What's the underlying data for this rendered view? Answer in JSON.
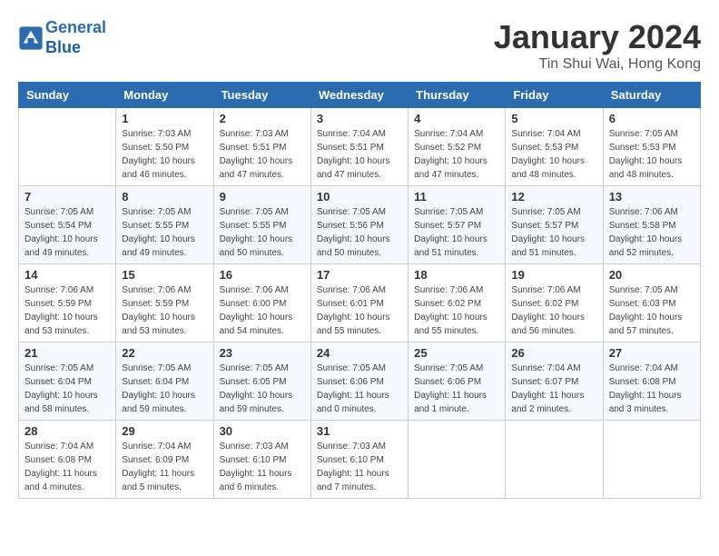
{
  "header": {
    "logo_line1": "General",
    "logo_line2": "Blue",
    "month_title": "January 2024",
    "location": "Tin Shui Wai, Hong Kong"
  },
  "weekdays": [
    "Sunday",
    "Monday",
    "Tuesday",
    "Wednesday",
    "Thursday",
    "Friday",
    "Saturday"
  ],
  "weeks": [
    [
      {
        "day": "",
        "sunrise": "",
        "sunset": "",
        "daylight": ""
      },
      {
        "day": "1",
        "sunrise": "Sunrise: 7:03 AM",
        "sunset": "Sunset: 5:50 PM",
        "daylight": "Daylight: 10 hours and 46 minutes."
      },
      {
        "day": "2",
        "sunrise": "Sunrise: 7:03 AM",
        "sunset": "Sunset: 5:51 PM",
        "daylight": "Daylight: 10 hours and 47 minutes."
      },
      {
        "day": "3",
        "sunrise": "Sunrise: 7:04 AM",
        "sunset": "Sunset: 5:51 PM",
        "daylight": "Daylight: 10 hours and 47 minutes."
      },
      {
        "day": "4",
        "sunrise": "Sunrise: 7:04 AM",
        "sunset": "Sunset: 5:52 PM",
        "daylight": "Daylight: 10 hours and 47 minutes."
      },
      {
        "day": "5",
        "sunrise": "Sunrise: 7:04 AM",
        "sunset": "Sunset: 5:53 PM",
        "daylight": "Daylight: 10 hours and 48 minutes."
      },
      {
        "day": "6",
        "sunrise": "Sunrise: 7:05 AM",
        "sunset": "Sunset: 5:53 PM",
        "daylight": "Daylight: 10 hours and 48 minutes."
      }
    ],
    [
      {
        "day": "7",
        "sunrise": "Sunrise: 7:05 AM",
        "sunset": "Sunset: 5:54 PM",
        "daylight": "Daylight: 10 hours and 49 minutes."
      },
      {
        "day": "8",
        "sunrise": "Sunrise: 7:05 AM",
        "sunset": "Sunset: 5:55 PM",
        "daylight": "Daylight: 10 hours and 49 minutes."
      },
      {
        "day": "9",
        "sunrise": "Sunrise: 7:05 AM",
        "sunset": "Sunset: 5:55 PM",
        "daylight": "Daylight: 10 hours and 50 minutes."
      },
      {
        "day": "10",
        "sunrise": "Sunrise: 7:05 AM",
        "sunset": "Sunset: 5:56 PM",
        "daylight": "Daylight: 10 hours and 50 minutes."
      },
      {
        "day": "11",
        "sunrise": "Sunrise: 7:05 AM",
        "sunset": "Sunset: 5:57 PM",
        "daylight": "Daylight: 10 hours and 51 minutes."
      },
      {
        "day": "12",
        "sunrise": "Sunrise: 7:05 AM",
        "sunset": "Sunset: 5:57 PM",
        "daylight": "Daylight: 10 hours and 51 minutes."
      },
      {
        "day": "13",
        "sunrise": "Sunrise: 7:06 AM",
        "sunset": "Sunset: 5:58 PM",
        "daylight": "Daylight: 10 hours and 52 minutes."
      }
    ],
    [
      {
        "day": "14",
        "sunrise": "Sunrise: 7:06 AM",
        "sunset": "Sunset: 5:59 PM",
        "daylight": "Daylight: 10 hours and 53 minutes."
      },
      {
        "day": "15",
        "sunrise": "Sunrise: 7:06 AM",
        "sunset": "Sunset: 5:59 PM",
        "daylight": "Daylight: 10 hours and 53 minutes."
      },
      {
        "day": "16",
        "sunrise": "Sunrise: 7:06 AM",
        "sunset": "Sunset: 6:00 PM",
        "daylight": "Daylight: 10 hours and 54 minutes."
      },
      {
        "day": "17",
        "sunrise": "Sunrise: 7:06 AM",
        "sunset": "Sunset: 6:01 PM",
        "daylight": "Daylight: 10 hours and 55 minutes."
      },
      {
        "day": "18",
        "sunrise": "Sunrise: 7:06 AM",
        "sunset": "Sunset: 6:02 PM",
        "daylight": "Daylight: 10 hours and 55 minutes."
      },
      {
        "day": "19",
        "sunrise": "Sunrise: 7:06 AM",
        "sunset": "Sunset: 6:02 PM",
        "daylight": "Daylight: 10 hours and 56 minutes."
      },
      {
        "day": "20",
        "sunrise": "Sunrise: 7:05 AM",
        "sunset": "Sunset: 6:03 PM",
        "daylight": "Daylight: 10 hours and 57 minutes."
      }
    ],
    [
      {
        "day": "21",
        "sunrise": "Sunrise: 7:05 AM",
        "sunset": "Sunset: 6:04 PM",
        "daylight": "Daylight: 10 hours and 58 minutes."
      },
      {
        "day": "22",
        "sunrise": "Sunrise: 7:05 AM",
        "sunset": "Sunset: 6:04 PM",
        "daylight": "Daylight: 10 hours and 59 minutes."
      },
      {
        "day": "23",
        "sunrise": "Sunrise: 7:05 AM",
        "sunset": "Sunset: 6:05 PM",
        "daylight": "Daylight: 10 hours and 59 minutes."
      },
      {
        "day": "24",
        "sunrise": "Sunrise: 7:05 AM",
        "sunset": "Sunset: 6:06 PM",
        "daylight": "Daylight: 11 hours and 0 minutes."
      },
      {
        "day": "25",
        "sunrise": "Sunrise: 7:05 AM",
        "sunset": "Sunset: 6:06 PM",
        "daylight": "Daylight: 11 hours and 1 minute."
      },
      {
        "day": "26",
        "sunrise": "Sunrise: 7:04 AM",
        "sunset": "Sunset: 6:07 PM",
        "daylight": "Daylight: 11 hours and 2 minutes."
      },
      {
        "day": "27",
        "sunrise": "Sunrise: 7:04 AM",
        "sunset": "Sunset: 6:08 PM",
        "daylight": "Daylight: 11 hours and 3 minutes."
      }
    ],
    [
      {
        "day": "28",
        "sunrise": "Sunrise: 7:04 AM",
        "sunset": "Sunset: 6:08 PM",
        "daylight": "Daylight: 11 hours and 4 minutes."
      },
      {
        "day": "29",
        "sunrise": "Sunrise: 7:04 AM",
        "sunset": "Sunset: 6:09 PM",
        "daylight": "Daylight: 11 hours and 5 minutes."
      },
      {
        "day": "30",
        "sunrise": "Sunrise: 7:03 AM",
        "sunset": "Sunset: 6:10 PM",
        "daylight": "Daylight: 11 hours and 6 minutes."
      },
      {
        "day": "31",
        "sunrise": "Sunrise: 7:03 AM",
        "sunset": "Sunset: 6:10 PM",
        "daylight": "Daylight: 11 hours and 7 minutes."
      },
      {
        "day": "",
        "sunrise": "",
        "sunset": "",
        "daylight": ""
      },
      {
        "day": "",
        "sunrise": "",
        "sunset": "",
        "daylight": ""
      },
      {
        "day": "",
        "sunrise": "",
        "sunset": "",
        "daylight": ""
      }
    ]
  ]
}
